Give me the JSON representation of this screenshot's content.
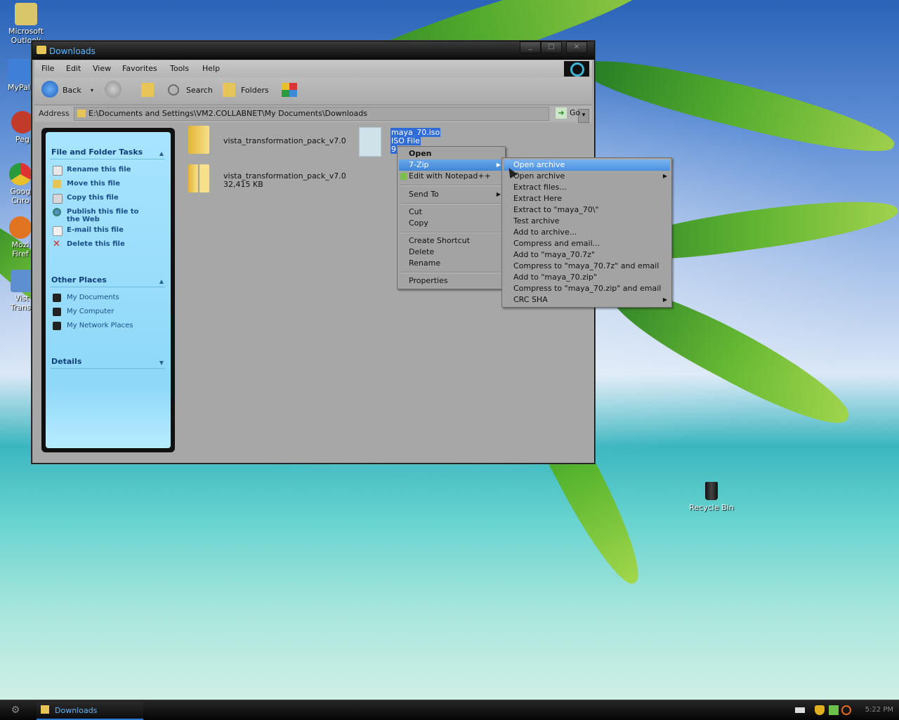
{
  "desktop": {
    "icons": [
      {
        "label": "Microsoft\nOutlook",
        "icon": "outlook-icon"
      },
      {
        "label": "MyPal",
        "icon": "mypal-icon"
      },
      {
        "label": "Peg",
        "icon": "peg-icon"
      },
      {
        "label": "Goog\nChro",
        "icon": "chrome-icon"
      },
      {
        "label": "Mozi\nFiref",
        "icon": "firefox-icon"
      },
      {
        "label": "Vist\nTransf",
        "icon": "vista-transform-icon"
      }
    ],
    "recycle_bin": "Recycle Bin"
  },
  "window": {
    "title": "Downloads",
    "controls": {
      "minimize": "_",
      "maximize": "□",
      "close": "×"
    },
    "menu": [
      "File",
      "Edit",
      "View",
      "Favorites",
      "Tools",
      "Help"
    ],
    "toolbar": {
      "back": "Back",
      "search": "Search",
      "folders": "Folders"
    },
    "address": {
      "label": "Address",
      "path": "E:\\Documents and Settings\\VM2.COLLABNET\\My Documents\\Downloads",
      "go": "Go"
    }
  },
  "task_pane": {
    "file_tasks": {
      "title": "File and Folder Tasks",
      "items": [
        "Rename this file",
        "Move this file",
        "Copy this file",
        "Publish this file to the Web",
        "E-mail this file",
        "Delete this file"
      ]
    },
    "other_places": {
      "title": "Other Places",
      "items": [
        "My Documents",
        "My Computer",
        "My Network Places"
      ]
    },
    "details": {
      "title": "Details"
    }
  },
  "files": [
    {
      "name": "vista_transformation_pack_v7.0",
      "detail": "",
      "type": "folder"
    },
    {
      "name": "vista_transformation_pack_v7.0",
      "detail": "32,415 KB",
      "type": "zip"
    },
    {
      "name": "maya_70.iso",
      "detail": "ISO File",
      "type": "iso",
      "extra": "9"
    }
  ],
  "context_menu": {
    "items": [
      {
        "label": "Open",
        "bold": true
      },
      {
        "label": "7-Zip",
        "highlighted": true,
        "submenu": true
      },
      {
        "label": "Edit with Notepad++"
      },
      {
        "label": "Send To",
        "submenu": true
      },
      {
        "label": "Cut"
      },
      {
        "label": "Copy"
      },
      {
        "label": "Create Shortcut"
      },
      {
        "label": "Delete"
      },
      {
        "label": "Rename"
      },
      {
        "label": "Properties"
      }
    ]
  },
  "submenu": {
    "items": [
      {
        "label": "Open archive",
        "highlighted": true
      },
      {
        "label": "Open archive",
        "submenu": true
      },
      {
        "label": "Extract files..."
      },
      {
        "label": "Extract Here"
      },
      {
        "label": "Extract to \"maya_70\\\""
      },
      {
        "label": "Test archive"
      },
      {
        "label": "Add to archive..."
      },
      {
        "label": "Compress and email..."
      },
      {
        "label": "Add to \"maya_70.7z\""
      },
      {
        "label": "Compress to \"maya_70.7z\" and email"
      },
      {
        "label": "Add to \"maya_70.zip\""
      },
      {
        "label": "Compress to \"maya_70.zip\" and email"
      },
      {
        "label": "CRC SHA",
        "submenu": true
      }
    ]
  },
  "taskbar": {
    "task": "Downloads",
    "clock": "5:22 PM"
  }
}
